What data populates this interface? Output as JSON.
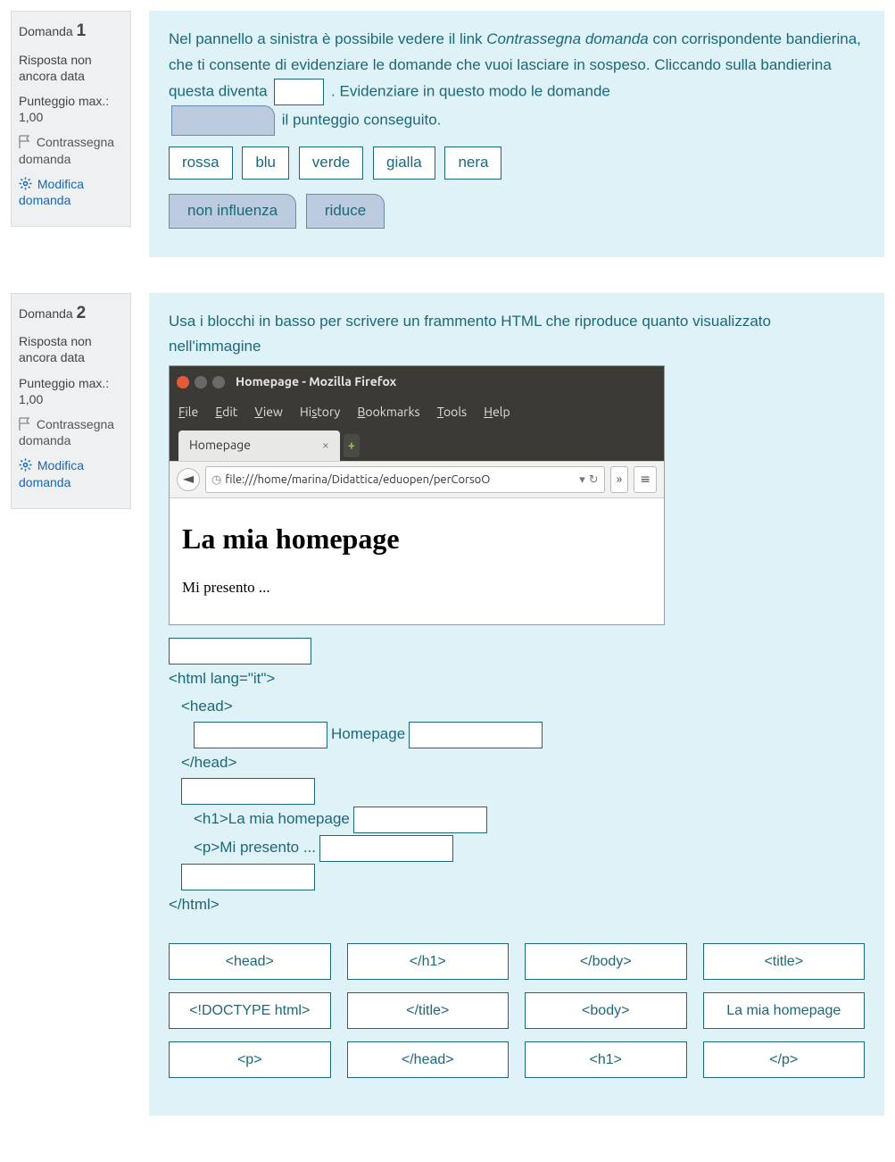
{
  "q1": {
    "label": "Domanda",
    "number": "1",
    "status": "Risposta non ancora data",
    "score": "Punteggio max.: 1,00",
    "flag": "Contrassegna domanda",
    "edit": "Modifica domanda",
    "text_a": "Nel pannello a sinistra è possibile vedere il link ",
    "text_a_em": "Contrassegna domanda",
    "text_b": " con corrispondente bandierina, che ti consente di evidenziare le domande che vuoi lasciare in sospeso. Cliccando sulla bandierina questa diventa ",
    "text_c": " . Evidenziare in questo modo le domande ",
    "text_d": " il punteggio conseguito.",
    "colors": [
      "rossa",
      "blu",
      "verde",
      "gialla",
      "nera"
    ],
    "effects": [
      "non influenza",
      "riduce"
    ]
  },
  "q2": {
    "label": "Domanda",
    "number": "2",
    "status": "Risposta non ancora data",
    "score": "Punteggio max.: 1,00",
    "flag": "Contrassegna domanda",
    "edit": "Modifica domanda",
    "prompt": "Usa i blocchi in basso per scrivere un frammento HTML che riproduce quanto visualizzato nell'immagine",
    "browser": {
      "title": "Homepage - Mozilla Firefox",
      "menu": [
        "File",
        "Edit",
        "View",
        "History",
        "Bookmarks",
        "Tools",
        "Help"
      ],
      "tab": "Homepage",
      "url": "file:///home/marina/Didattica/eduopen/perCorsoO",
      "h1": "La mia homepage",
      "p": "Mi presento ..."
    },
    "code": {
      "l_html_open": "<html lang=\"it\">",
      "l_head_open": "<head>",
      "l_title_text": "Homepage",
      "l_head_close": "</head>",
      "l_h1": "<h1>La mia homepage",
      "l_p": "<p>Mi presento ...",
      "l_html_close": "</html>"
    },
    "bank": [
      [
        "<head>",
        "</h1>",
        "</body>",
        "<title>"
      ],
      [
        "<!DOCTYPE html>",
        "</title>",
        "<body>",
        "La mia homepage"
      ],
      [
        "<p>",
        "</head>",
        "<h1>",
        "</p>"
      ]
    ]
  }
}
